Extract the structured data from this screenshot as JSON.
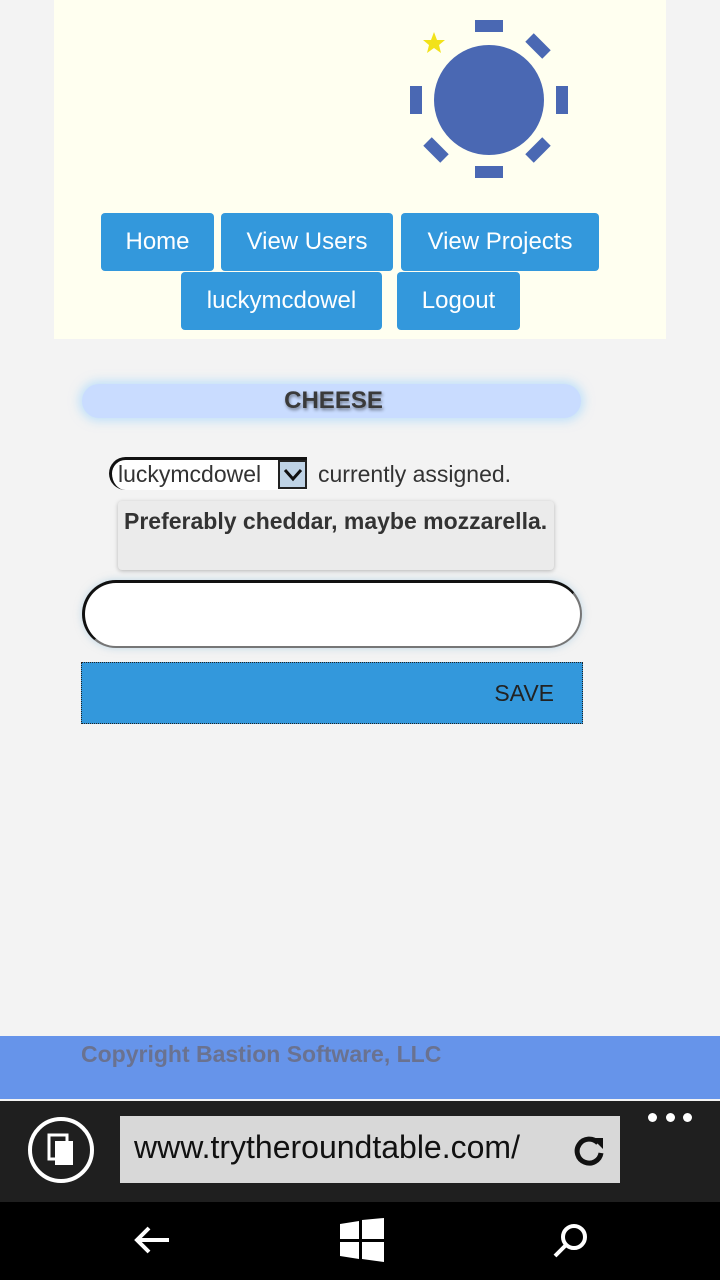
{
  "header": {
    "logo_icon": "round-table-logo-icon",
    "nav": {
      "home": "Home",
      "view_users": "View Users",
      "view_projects": "View Projects",
      "user": "luckymcdowel",
      "logout": "Logout"
    }
  },
  "project": {
    "title": "CHEESE",
    "assignee_select": {
      "selected": "luckymcdowel"
    },
    "assigned_suffix": "currently assigned.",
    "description": "Preferably cheddar, maybe mozzarella.",
    "comment_input": {
      "value": "",
      "placeholder": ""
    },
    "save_label": "SAVE"
  },
  "footer": {
    "copyright": "Copyright Bastion Software, LLC"
  },
  "browser": {
    "url": "www.trytheroundtable.com/",
    "icons": [
      "tabs-icon",
      "refresh-icon",
      "more-icon"
    ]
  },
  "system_nav": {
    "icons": [
      "back-icon",
      "windows-icon",
      "search-icon"
    ]
  },
  "colors": {
    "header_bg": "#fffff0",
    "button_blue": "#3398dc",
    "title_pill": "#c9dcff",
    "footer_blue": "#6694ea",
    "logo_blue": "#4a68b3",
    "star_yellow": "#f2e21a"
  }
}
